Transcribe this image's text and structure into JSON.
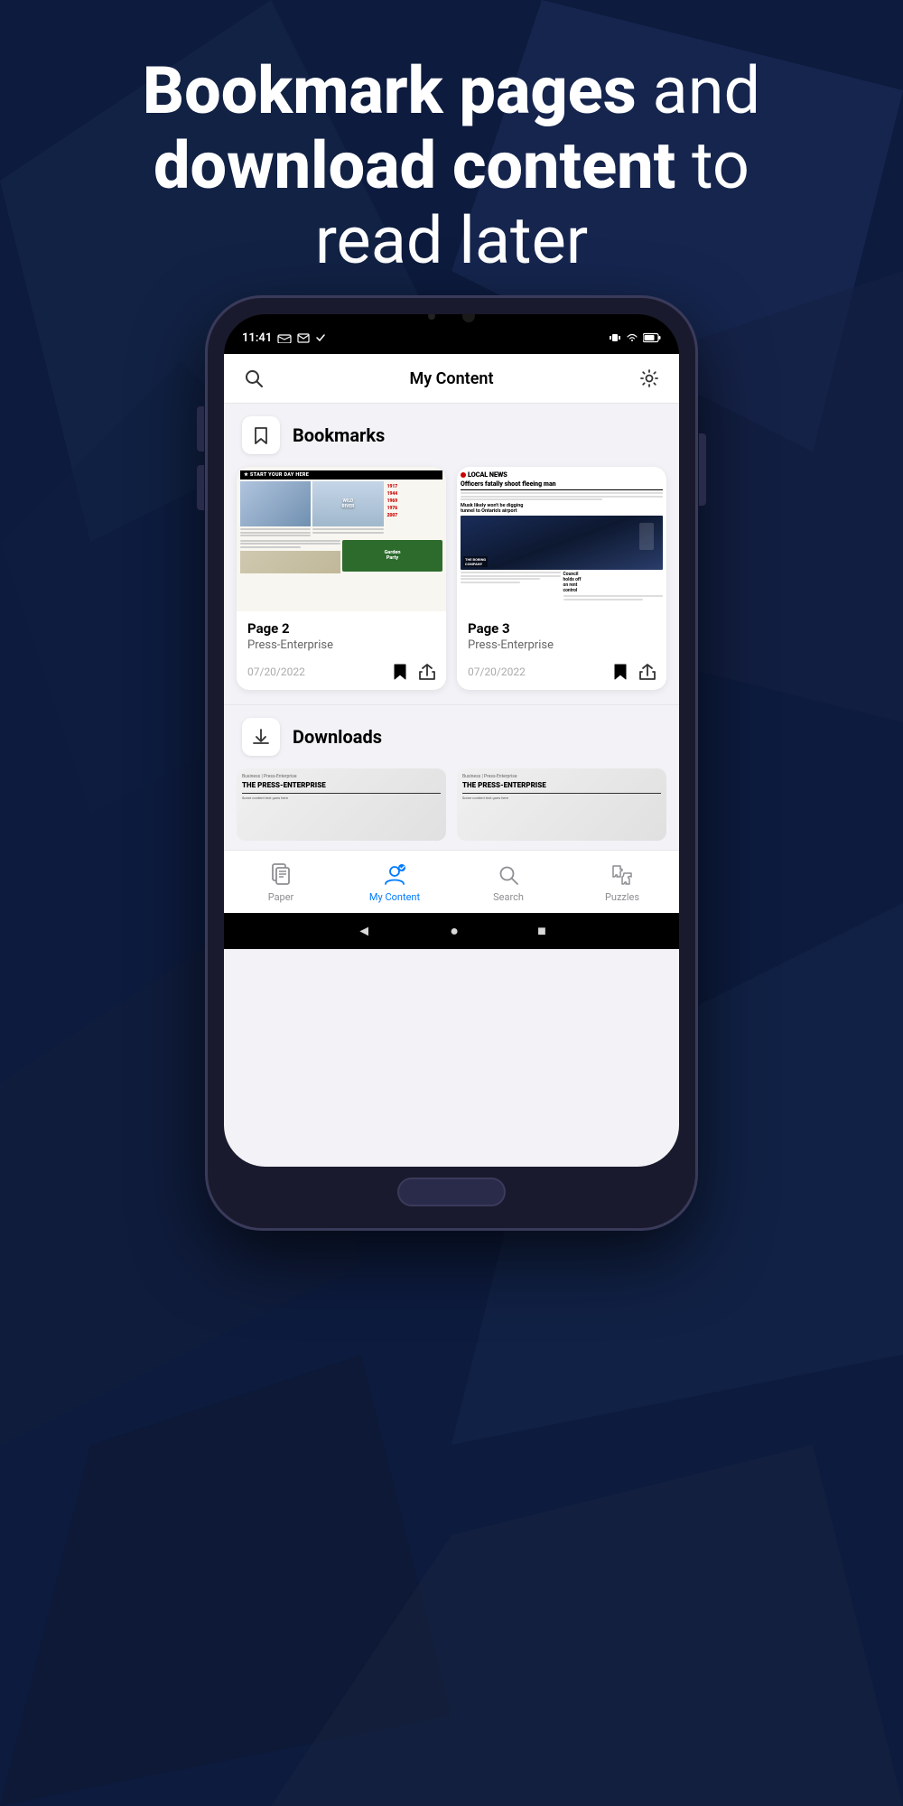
{
  "hero": {
    "line1_bold": "Bookmark pages",
    "line1_normal": " and",
    "line2_bold": "download content",
    "line2_normal": " to",
    "line3": "read later"
  },
  "status_bar": {
    "time": "11:41",
    "battery": "🔋"
  },
  "app_header": {
    "title": "My Content",
    "search_icon": "search",
    "settings_icon": "settings"
  },
  "bookmarks_section": {
    "label": "Bookmarks",
    "icon": "bookmark"
  },
  "cards": [
    {
      "page": "Page 2",
      "publisher": "Press-Enterprise",
      "date": "07/20/2022"
    },
    {
      "page": "Page 3",
      "publisher": "Press-Enterprise",
      "date": "07/20/2022"
    }
  ],
  "downloads_section": {
    "label": "Downloads",
    "icon": "download"
  },
  "bottom_nav": {
    "items": [
      {
        "label": "Paper",
        "icon": "paper",
        "active": false
      },
      {
        "label": "My Content",
        "icon": "person",
        "active": true
      },
      {
        "label": "Search",
        "icon": "search",
        "active": false
      },
      {
        "label": "Puzzles",
        "icon": "puzzle",
        "active": false
      }
    ]
  },
  "news_page2": {
    "header": "START YOUR DAY HERE",
    "dates": [
      "1917",
      "1944",
      "1969",
      "1976",
      "2007"
    ]
  },
  "news_page3": {
    "section": "LOCAL NEWS",
    "headline": "Officers fatally shoot fleeing man",
    "subhead": "Musk likely won't be digging tunnel to Ontario's airport"
  }
}
